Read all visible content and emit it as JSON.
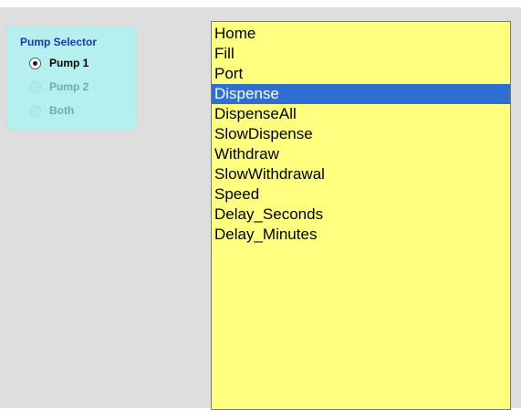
{
  "pump_selector": {
    "title": "Pump Selector",
    "options": [
      {
        "label": "Pump 1",
        "checked": true,
        "enabled": true
      },
      {
        "label": "Pump 2",
        "checked": false,
        "enabled": false
      },
      {
        "label": "Both",
        "checked": false,
        "enabled": false
      }
    ]
  },
  "commands": {
    "items": [
      "Home",
      "Fill",
      "Port",
      "Dispense",
      "DispenseAll",
      "SlowDispense",
      "Withdraw",
      "SlowWithdrawal",
      "Speed",
      "Delay_Seconds",
      "Delay_Minutes"
    ],
    "selected": "Dispense"
  },
  "colors": {
    "window_background": "#dedede",
    "group_background": "#b6efef",
    "group_title": "#1d3aa8",
    "list_background": "#ffff80",
    "selection": "#2f6fd3"
  }
}
